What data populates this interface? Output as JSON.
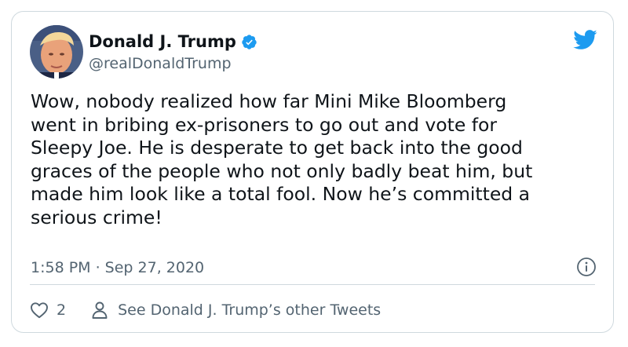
{
  "tweet": {
    "display_name": "Donald J. Trump",
    "handle": "@realDonaldTrump",
    "text": "Wow, nobody realized how far Mini Mike Bloomberg\nwent in bribing ex-prisoners to go out and vote for\nSleepy Joe. He is desperate to get back into the good\ngraces of the people who not only badly beat him, but\nmade him look like a total fool. Now he’s committed a\nserious crime!",
    "timestamp": "1:58 PM · Sep 27, 2020",
    "like_count": "2",
    "other_tweets_label": "See Donald J. Trump’s other Tweets"
  },
  "icons": {
    "verified": "verified-badge-icon",
    "brand": "twitter-bird-icon",
    "info": "info-icon",
    "like": "heart-icon",
    "profile": "person-icon"
  },
  "colors": {
    "brand_blue": "#1d9bf0",
    "text_primary": "#0f1419",
    "text_secondary": "#536471",
    "border": "#cfd9de"
  }
}
